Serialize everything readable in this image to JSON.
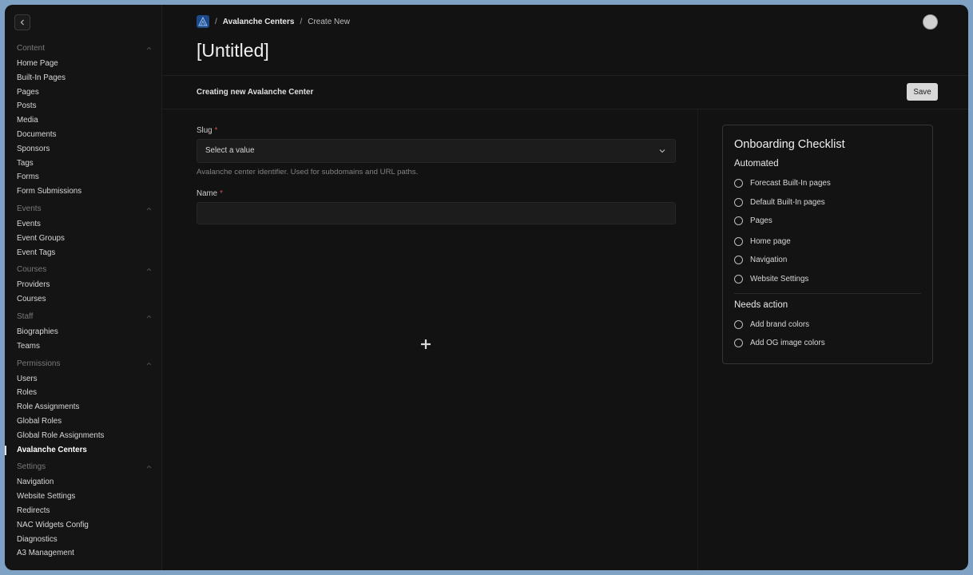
{
  "sidebar": {
    "groups": [
      {
        "label": "Content",
        "items": [
          "Home Page",
          "Built-In Pages",
          "Pages",
          "Posts",
          "Media",
          "Documents",
          "Sponsors",
          "Tags",
          "Forms",
          "Form Submissions"
        ]
      },
      {
        "label": "Events",
        "items": [
          "Events",
          "Event Groups",
          "Event Tags"
        ]
      },
      {
        "label": "Courses",
        "items": [
          "Providers",
          "Courses"
        ]
      },
      {
        "label": "Staff",
        "items": [
          "Biographies",
          "Teams"
        ]
      },
      {
        "label": "Permissions",
        "items": [
          "Users",
          "Roles",
          "Role Assignments",
          "Global Roles",
          "Global Role Assignments",
          "Avalanche Centers"
        ]
      },
      {
        "label": "Settings",
        "items": [
          "Navigation",
          "Website Settings",
          "Redirects",
          "NAC Widgets Config",
          "Diagnostics",
          "A3 Management"
        ]
      }
    ],
    "active_item": "Avalanche Centers"
  },
  "breadcrumb": {
    "separator": "/",
    "link": "Avalanche Centers",
    "current": "Create New"
  },
  "page": {
    "title": "[Untitled]",
    "subheader": "Creating new Avalanche Center",
    "save_label": "Save"
  },
  "form": {
    "slug": {
      "label": "Slug",
      "required_mark": "*",
      "placeholder": "Select a value",
      "helper": "Avalanche center identifier. Used for subdomains and URL paths."
    },
    "name": {
      "label": "Name",
      "required_mark": "*",
      "value": ""
    }
  },
  "checklist": {
    "title": "Onboarding Checklist",
    "automated_label": "Automated",
    "automated": [
      "Forecast Built-In pages",
      "Default Built-In pages",
      "Pages",
      "Home page",
      "Navigation",
      "Website Settings"
    ],
    "needs_action_label": "Needs action",
    "needs_action": [
      "Add brand colors",
      "Add OG image colors"
    ]
  },
  "colors": {
    "background": "#121212",
    "accent_logo": "#1d4a8a",
    "required": "#d05050",
    "save_button": "#d8d8d8"
  }
}
